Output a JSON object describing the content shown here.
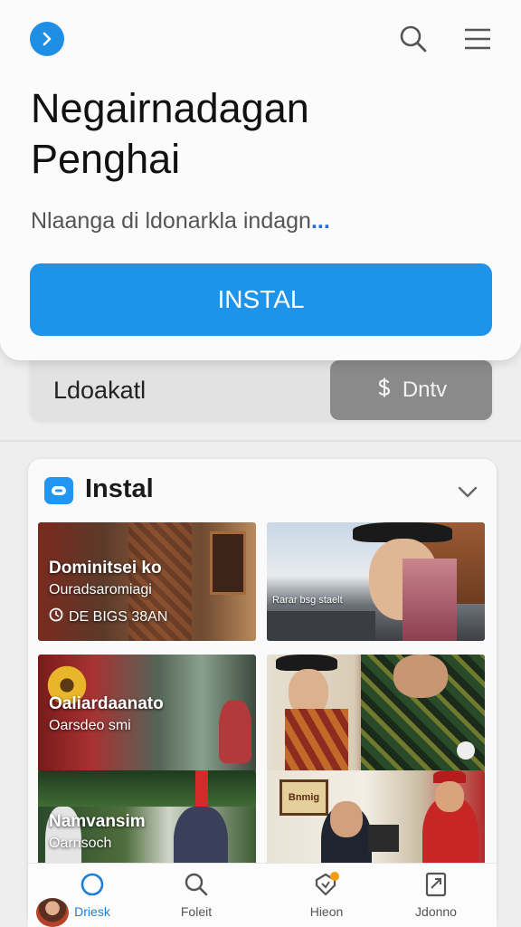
{
  "header": {
    "title_line1": "Negairnadagan",
    "title_line2": "Penghai",
    "subtitle": "Nlaanga di ldonarkla indagn",
    "subtitle_ellipsis": "...",
    "install_label": "INSTAL",
    "icons": [
      "arrow-right-icon",
      "search-icon",
      "menu-icon"
    ]
  },
  "filter": {
    "label": "Ldoakatl",
    "button_label": "Dntv",
    "button_icon": "dollar-icon"
  },
  "section": {
    "title": "Instal",
    "icon": "chat-bubble-icon",
    "tiles": [
      {
        "title": "Dominitsei  ko",
        "sub": "Ouradsaromiagi",
        "badge": "DE BIGS 38AN"
      },
      {
        "caption": "Rarar bsg staelt"
      },
      {
        "title": "Oaliardaanato",
        "sub": "Oarsdeo smi"
      },
      {
        "caption": ""
      },
      {
        "title": "Namvansim",
        "sub": "Oarnsoch"
      },
      {
        "title": "Bnmig"
      }
    ]
  },
  "nav": {
    "items": [
      {
        "label": "Driesk",
        "icon": "home-circle-icon",
        "active": true
      },
      {
        "label": "Foleit",
        "icon": "search-icon",
        "active": false
      },
      {
        "label": "Hieon",
        "icon": "tag-badge-icon",
        "active": false
      },
      {
        "label": "Jdonno",
        "icon": "profile-card-icon",
        "active": false
      }
    ]
  },
  "colors": {
    "accent": "#1e93ea",
    "filter_button": "#8a8a8a",
    "active_nav": "#1e7fd6"
  }
}
